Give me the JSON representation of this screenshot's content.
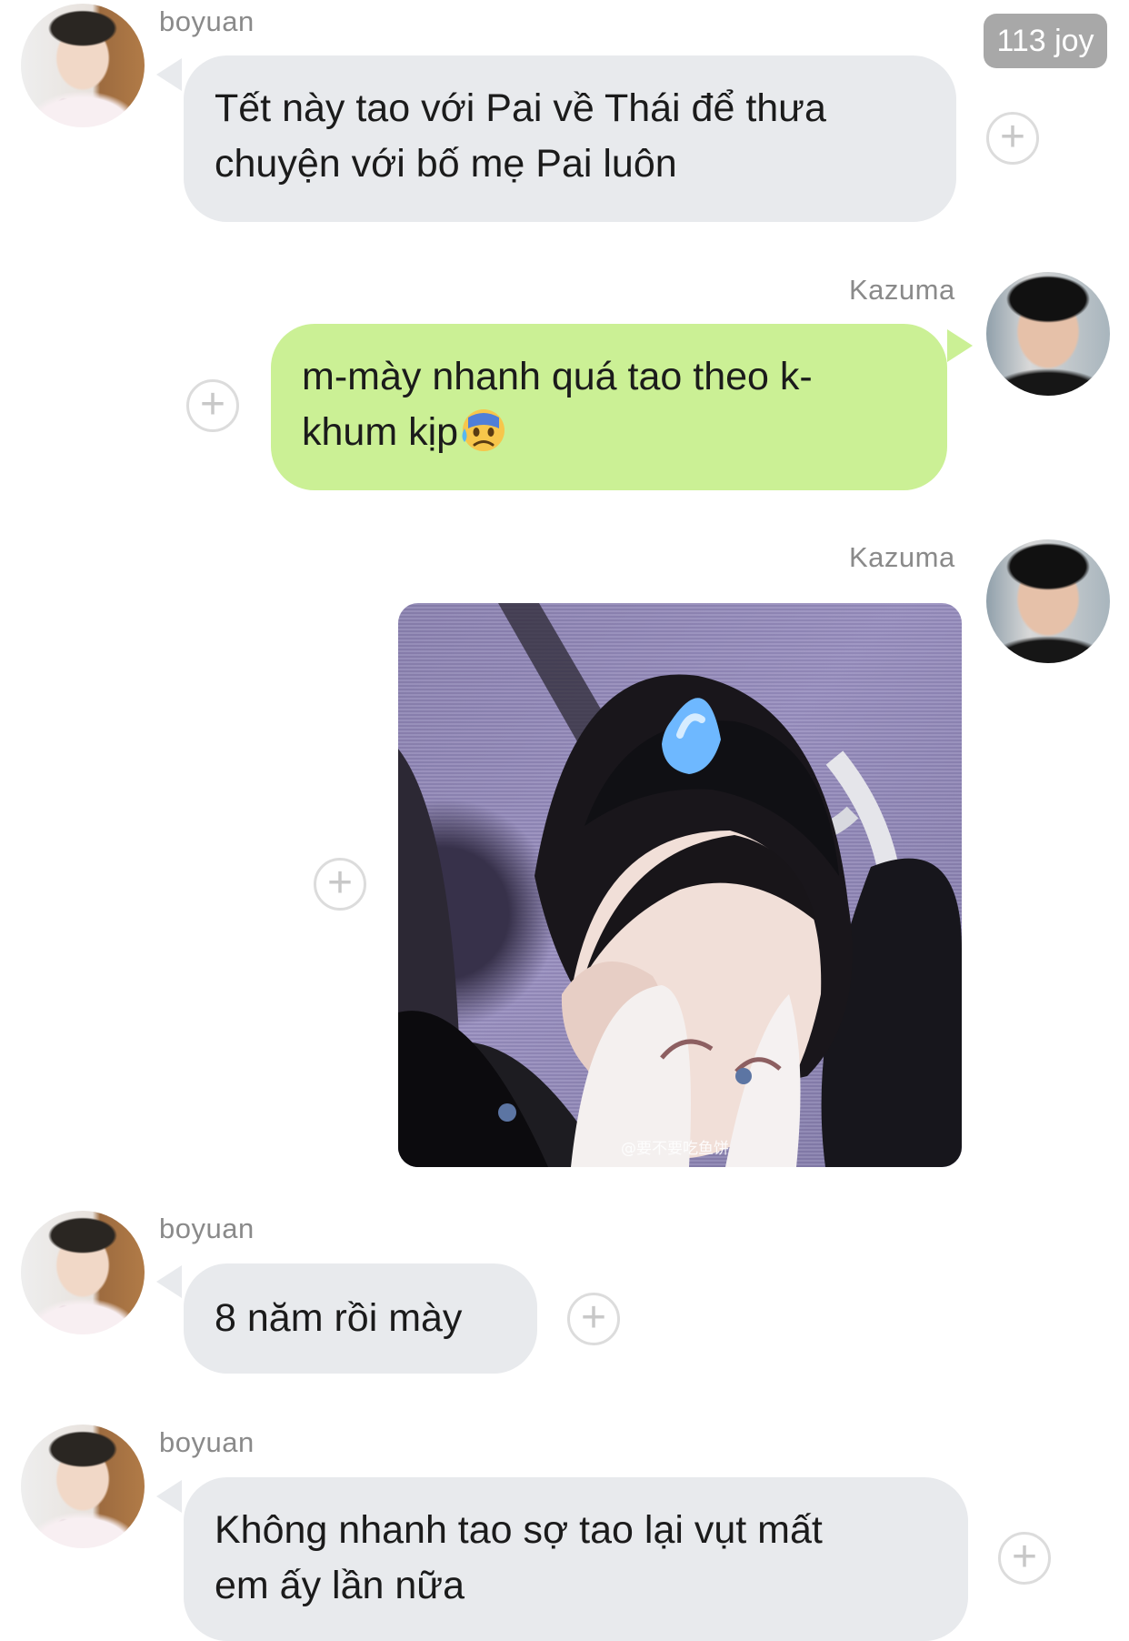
{
  "header": {
    "badge_text": "113 joy"
  },
  "messages": [
    {
      "sender": "boyuan",
      "text_line1": "Tết này tao với Pai về Thái để thưa",
      "text_line2": "chuyện với bố mẹ Pai luôn"
    },
    {
      "sender": "Kazuma",
      "text_line1": "m-mày nhanh quá tao theo k-",
      "text_line2": "khum kịp"
    },
    {
      "sender": "Kazuma",
      "image_watermark": "@要不要吃鱼饼"
    },
    {
      "sender": "boyuan",
      "text_line1": "8 năm rồi mày"
    },
    {
      "sender": "boyuan",
      "text_line1": "Không nhanh tao sợ tao lại vụt mất",
      "text_line2": "em ấy lần nữa"
    }
  ],
  "icons": {
    "plus": "+",
    "emoji": "anxious-face-with-sweat",
    "avatar_boyuan": "avatar-boyuan",
    "avatar_kazuma": "avatar-kazuma"
  },
  "colors": {
    "incoming_bubble": "#e8eaed",
    "outgoing_bubble": "#cbf095",
    "name_text": "#8a8a8a",
    "badge": "#a8a8a8"
  }
}
